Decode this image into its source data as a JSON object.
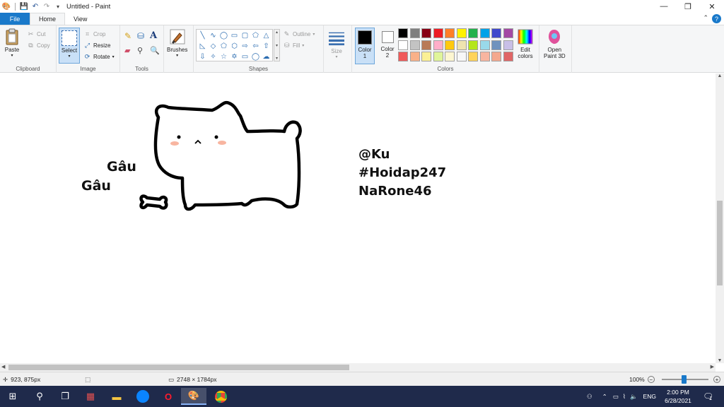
{
  "window": {
    "title": "Untitled - Paint"
  },
  "tabs": [
    {
      "label": "File"
    },
    {
      "label": "Home"
    },
    {
      "label": "View"
    }
  ],
  "ribbon": {
    "clipboard": {
      "label": "Clipboard",
      "paste": "Paste",
      "cut": "Cut",
      "copy": "Copy"
    },
    "image": {
      "label": "Image",
      "select": "Select",
      "crop": "Crop",
      "resize": "Resize",
      "rotate": "Rotate"
    },
    "tools": {
      "label": "Tools"
    },
    "brushes": {
      "label": "Brushes"
    },
    "shapes": {
      "label": "Shapes",
      "outline": "Outline",
      "fill": "Fill"
    },
    "size": {
      "label": "Size"
    },
    "colors": {
      "label": "Colors",
      "color1": "Color\n1",
      "color1_label": "Color",
      "color1_num": "1",
      "color2_label": "Color",
      "color2_num": "2",
      "color1_value": "#000000",
      "color2_value": "#ffffff",
      "edit": "Edit",
      "edit2": "colors",
      "palette": [
        "#000000",
        "#7f7f7f",
        "#880015",
        "#ed1c24",
        "#ff7f27",
        "#fff200",
        "#22b14c",
        "#00a2e8",
        "#3f48cc",
        "#a349a4",
        "#ffffff",
        "#c3c3c3",
        "#b97a57",
        "#ffaec9",
        "#ffc90e",
        "#efe4b0",
        "#b5e61d",
        "#99d9ea",
        "#7092be",
        "#c8bfe7",
        "#f05a5a",
        "#f9b189",
        "#fbf095",
        "#e0f59a",
        "#fdf6d0",
        "#f7f7f7",
        "#ffd35a",
        "#f8b5a0",
        "#f4a88e",
        "#e06666"
      ]
    },
    "paint3d": {
      "line1": "Open",
      "line2": "Paint 3D"
    }
  },
  "canvas": {
    "texts": [
      {
        "text": "Gâu"
      },
      {
        "text": "Gâu"
      },
      {
        "text": "@Ku"
      },
      {
        "text": "#Hoidap247"
      },
      {
        "text": "NaRone46"
      }
    ]
  },
  "status": {
    "cursor_pos": "923, 875px",
    "image_size": "2748 × 1784px",
    "zoom": "100%"
  },
  "taskbar": {
    "language": "ENG",
    "time": "2:00 PM",
    "date": "6/28/2021",
    "notifications": "1"
  }
}
